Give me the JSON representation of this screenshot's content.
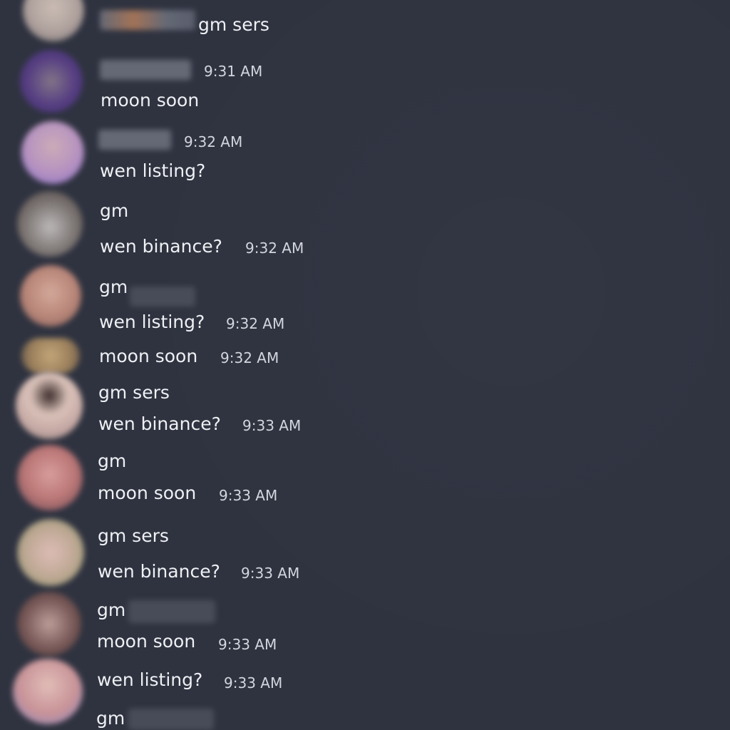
{
  "messages": {
    "m0": {
      "text": "gm sers"
    },
    "m1": {
      "time": "9:31 AM",
      "text": "moon soon"
    },
    "m2": {
      "time": "9:32 AM",
      "text": "wen listing?"
    },
    "m3": {
      "line1": "gm",
      "line2": "wen binance?",
      "time": "9:32 AM"
    },
    "m4": {
      "line1": "gm",
      "line2": "wen listing?",
      "time": "9:32 AM"
    },
    "m5": {
      "text": "moon soon",
      "time": "9:32 AM"
    },
    "m6": {
      "line1": "gm sers",
      "line2": "wen binance?",
      "time": "9:33 AM"
    },
    "m7": {
      "line1": "gm",
      "line2": "moon soon",
      "time": "9:33 AM"
    },
    "m8": {
      "line1": "gm sers",
      "line2": "wen binance?",
      "time": "9:33 AM"
    },
    "m9": {
      "line1": "gm",
      "line2": "moon soon",
      "time": "9:33 AM"
    },
    "m10": {
      "text": "wen listing?",
      "time": "9:33 AM"
    },
    "m11": {
      "text": "gm"
    }
  }
}
